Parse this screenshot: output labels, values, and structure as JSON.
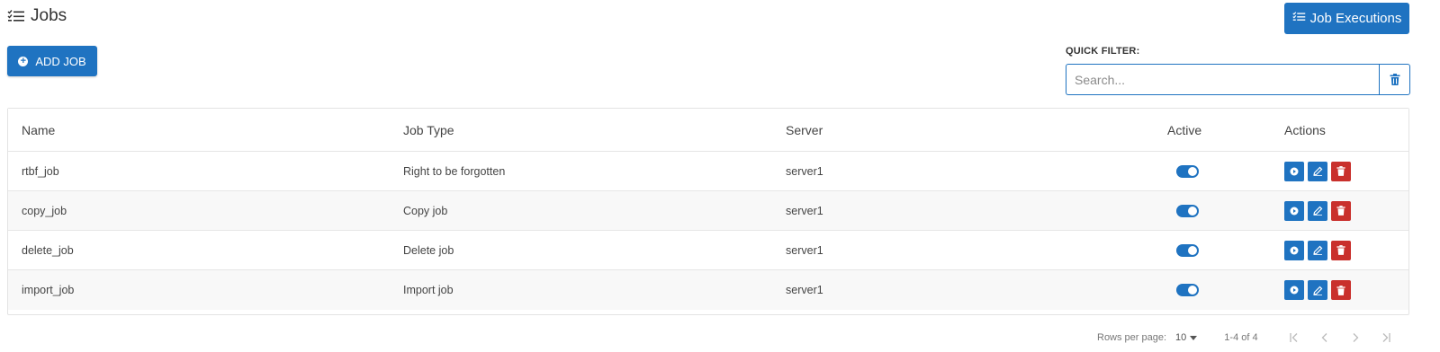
{
  "header": {
    "title": "Jobs",
    "job_executions_label": "Job Executions",
    "add_job_label": "ADD JOB"
  },
  "filter": {
    "label": "QUICK FILTER:",
    "placeholder": "Search...",
    "value": ""
  },
  "table": {
    "columns": [
      "Name",
      "Job Type",
      "Server",
      "Active",
      "Actions"
    ],
    "rows": [
      {
        "name": "rtbf_job",
        "job_type": "Right to be forgotten",
        "server": "server1",
        "active": true
      },
      {
        "name": "copy_job",
        "job_type": "Copy job",
        "server": "server1",
        "active": true
      },
      {
        "name": "delete_job",
        "job_type": "Delete job",
        "server": "server1",
        "active": true
      },
      {
        "name": "import_job",
        "job_type": "Import job",
        "server": "server1",
        "active": true
      }
    ]
  },
  "pagination": {
    "rows_per_page_label": "Rows per page:",
    "rows_per_page_value": "10",
    "range": "1-4 of 4"
  },
  "icons": {
    "title": "checklist-icon",
    "add": "plus-circle-icon",
    "clear": "trash-icon",
    "run": "play-icon",
    "edit": "edit-icon",
    "delete": "trash-icon"
  },
  "colors": {
    "primary": "#1f73c1",
    "danger": "#c9302c"
  }
}
